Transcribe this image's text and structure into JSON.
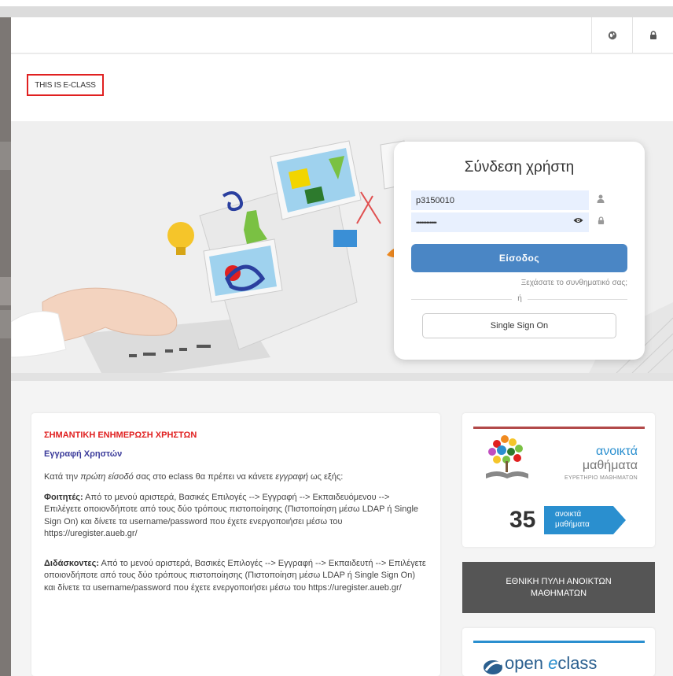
{
  "topbar": {
    "language_icon": "globe-icon",
    "login_icon": "lock-icon"
  },
  "brand": {
    "text": "THIS IS E-CLASS"
  },
  "login": {
    "title": "Σύνδεση χρήστη",
    "username_value": "p3150010",
    "password_value": "••••••••••••",
    "submit_label": "Είσοδος",
    "forgot_label": "Ξεχάσατε το συνθηματικό σας;",
    "or_label": "ή",
    "sso_label": "Single Sign On"
  },
  "news": {
    "title": "ΣΗΜΑΝΤΙΚΗ ΕΝΗΜΕΡΩΣΗ ΧΡΗΣΤΩΝ",
    "subtitle": "Εγγραφή Χρηστών",
    "intro_prefix": "Κατά την ",
    "intro_em1": "πρώτη είσοδό",
    "intro_mid": " σας στο eclass θα πρέπει να κάνετε ",
    "intro_em2": "εγγραφή",
    "intro_suffix": " ως εξής:",
    "students_label": "Φοιτητές:",
    "students_text": " Από το μενού αριστερά, Βασικές Επιλογές --> Εγγραφή --> Εκπαιδευόμενου --> Επιλέγετε οποιονδήποτε από τους δύο τρόπους πιστοποίησης (Πιστοποίηση μέσω LDAP ή Single Sign On) και δίνετε τα username/password  που έχετε ενεργοποιήσει μέσω του https://uregister.aueb.gr/",
    "teachers_label": "Διδάσκοντες:",
    "teachers_text": " Από το μενού αριστερά, Βασικές Επιλογές --> Εγγραφή --> Εκπαιδευτή --> Επιλέγετε οποιονδήποτε από τους δύο τρόπους πιστοποίησης (Πιστοποίηση μέσω LDAP ή Single Sign On) και δίνετε τα username/password που έχετε ενεργοποιήσει μέσω του https://uregister.aueb.gr/"
  },
  "open_courses": {
    "line1": "ανοικτά",
    "line2": "μαθήματα",
    "line3": "ΕΥΡΕΤΗΡΙΟ ΜΑΘΗΜΑΤΩΝ",
    "count": "35",
    "tag_line1": "ανοικτά",
    "tag_line2": "μαθήματα"
  },
  "portal": {
    "label": "ΕΘΝΙΚΗ ΠΥΛΗ ΑΝΟΙΚΤΩΝ ΜΑΘΗΜΑΤΩΝ"
  },
  "eclass_logo": {
    "word1": "open ",
    "e": "e",
    "word2": "class"
  },
  "colors": {
    "accent_blue": "#4a86c5",
    "brand_red": "#e02020",
    "open_blue": "#2a8fcf"
  }
}
